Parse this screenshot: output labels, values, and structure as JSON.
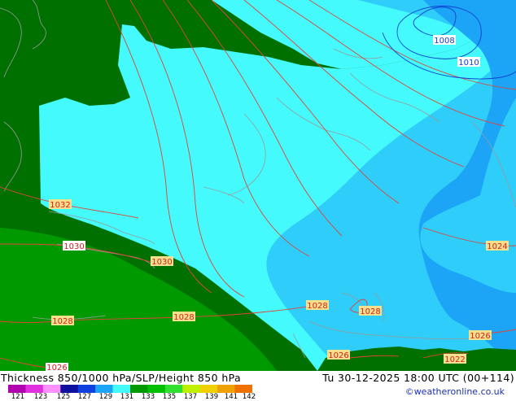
{
  "header": {
    "title": "Thickness 850/1000 hPa/SLP/Height 850 hPa",
    "datetime": "Tu 30-12-2025 18:00 UTC (00+114)",
    "copyright": "©weatheronline.co.uk"
  },
  "colors": {
    "thickness_dark_green": "#007000",
    "thickness_green": "#009a00",
    "thickness_cyan": "#44fafc",
    "thickness_light_blue": "#2ecdfa",
    "thickness_mid_blue": "#1ca4f6",
    "isobar_red": "#e0453a",
    "isobar_blue": "#1040d0",
    "coastline": "#9a9a9a",
    "label_bg": "#f7e08c"
  },
  "isobar_labels": [
    {
      "text": "1008",
      "color": "blue"
    },
    {
      "text": "1010",
      "color": "blue"
    },
    {
      "text": "1032",
      "color": "red"
    },
    {
      "text": "1030",
      "color": "red"
    },
    {
      "text": "1030",
      "color": "red"
    },
    {
      "text": "1028",
      "color": "red"
    },
    {
      "text": "1028",
      "color": "red"
    },
    {
      "text": "1028",
      "color": "red"
    },
    {
      "text": "1028",
      "color": "red"
    },
    {
      "text": "1026",
      "color": "red"
    },
    {
      "text": "1026",
      "color": "red"
    },
    {
      "text": "1026",
      "color": "red"
    },
    {
      "text": "1024",
      "color": "red"
    },
    {
      "text": "1022",
      "color": "red"
    }
  ],
  "colorbar": {
    "ticks": [
      "121",
      "123",
      "125",
      "127",
      "129",
      "131",
      "133",
      "135",
      "137",
      "139",
      "141",
      "142"
    ],
    "colors": [
      "#b000b0",
      "#e030e0",
      "#ff90ff",
      "#1010a0",
      "#1040e0",
      "#1ca4f6",
      "#44fafc",
      "#009a00",
      "#00c000",
      "#30e030",
      "#c0f000",
      "#f0d000",
      "#f0a000",
      "#f07000"
    ]
  }
}
